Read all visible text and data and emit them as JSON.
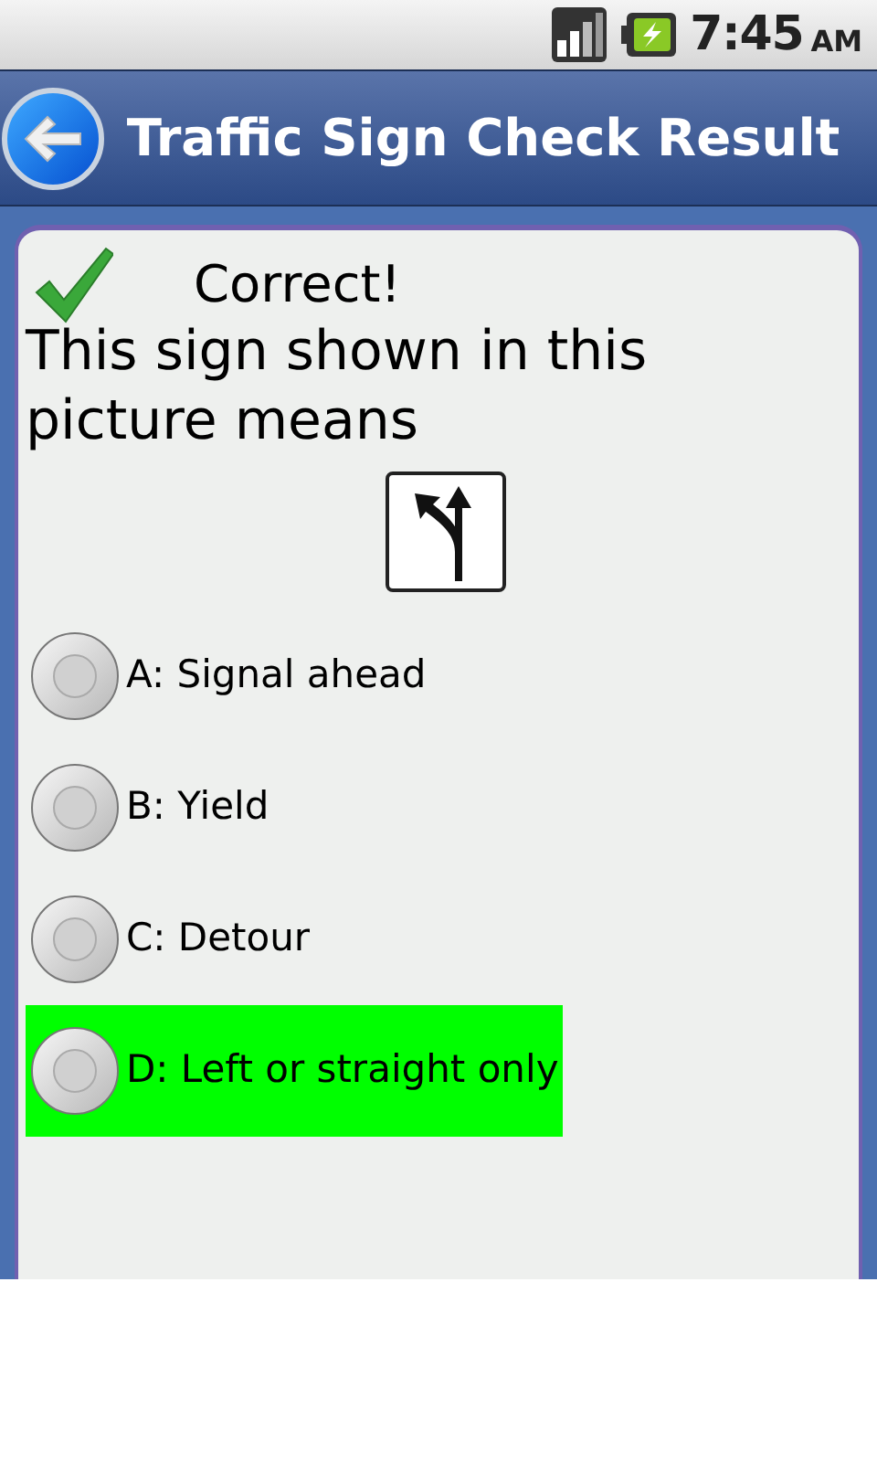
{
  "status_bar": {
    "time": "7:45",
    "meridiem": "AM"
  },
  "title_bar": {
    "title": "Traffic Sign Check Result"
  },
  "result": {
    "kind": "correct",
    "text": "Correct!"
  },
  "question": "This sign shown in this picture means",
  "options": [
    {
      "label": "A: Signal ahead",
      "checked": false,
      "correct": false
    },
    {
      "label": "B: Yield",
      "checked": false,
      "correct": false
    },
    {
      "label": "C: Detour",
      "checked": false,
      "correct": false
    },
    {
      "label": "D: Left or straight only",
      "checked": false,
      "correct": true
    }
  ]
}
